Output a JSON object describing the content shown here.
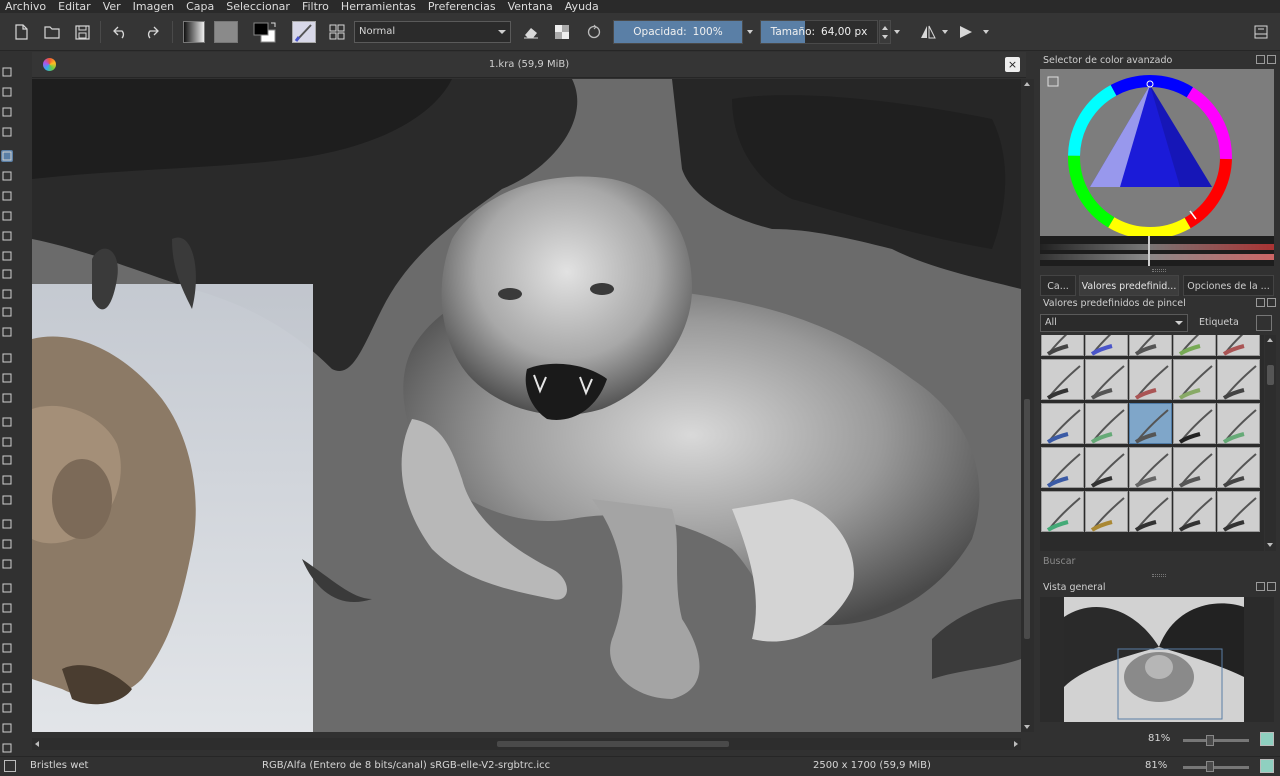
{
  "menu": [
    "Archivo",
    "Editar",
    "Ver",
    "Imagen",
    "Capa",
    "Seleccionar",
    "Filtro",
    "Herramientas",
    "Preferencias",
    "Ventana",
    "Ayuda"
  ],
  "toolbar": {
    "blend_mode": "Normal",
    "opacity_label": "Opacidad:",
    "opacity_value": "100%",
    "opacity_fraction": 1.0,
    "size_label": "Tamaño:",
    "size_value": "64,00 px",
    "size_fraction": 0.38
  },
  "document": {
    "title": "1.kra (59,9 MiB)",
    "close_glyph": "×"
  },
  "panels": {
    "color_selector_title": "Selector de color avanzado",
    "tabs": [
      "Ca...",
      "Valores predefinid...",
      "Opciones de la ..."
    ],
    "presets_title": "Valores predefinidos de pincel",
    "preset_filter": "All",
    "tag_label": "Etiqueta",
    "search_placeholder": "Buscar",
    "overview_title": "Vista general",
    "zoom_1": "81%"
  },
  "status": {
    "preset_name": "Bristles wet",
    "color_model": "RGB/Alfa (Entero de 8 bits/canal)  sRGB-elle-V2-srgbtrc.icc",
    "dimensions": "2500 x 1700 (59,9 MiB)",
    "zoom": "81%"
  },
  "colors": {
    "accent": "#5a7fa6",
    "background": "#313131"
  }
}
